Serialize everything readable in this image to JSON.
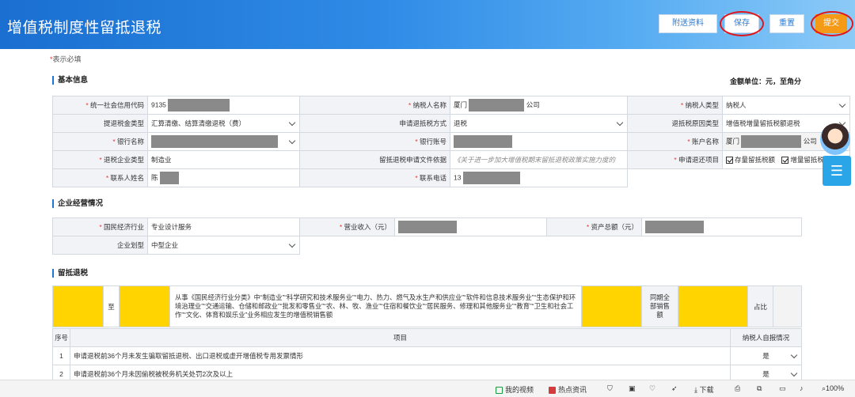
{
  "header": {
    "title": "增值税制度性留抵退税",
    "buttons": {
      "attach": "附送资料",
      "save": "保存",
      "reset": "重置",
      "submit": "提交"
    }
  },
  "required_note": {
    "star": "*",
    "text": "表示必填"
  },
  "basic": {
    "section_title": "基本信息",
    "unit_note": "金额单位：元，至角分",
    "credit_code_label": "统一社会信用代码",
    "credit_code_value": "9135",
    "taxpayer_name_label": "纳税人名称",
    "taxpayer_name_prefix": "厦门",
    "taxpayer_name_suffix": "公司",
    "taxpayer_type_label": "纳税人类型",
    "taxpayer_type_value": "纳税人",
    "refund_amount_type_label": "提退税金类型",
    "refund_amount_type_value": "汇算清缴、结算清缴退税（费）",
    "refund_method_label": "申请退抵税方式",
    "refund_method_value": "退税",
    "refund_reason_type_label": "退抵税原因类型",
    "refund_reason_type_value": "增值税增量留抵税额退税",
    "bank_name_label": "银行名称",
    "bank_account_label": "银行账号",
    "account_name_label": "账户名称",
    "account_name_prefix": "厦门",
    "account_name_suffix": "公司",
    "enterprise_type_label": "退税企业类型",
    "enterprise_type_value": "制造业",
    "policy_doc_label": "留抵退税申请文件依据",
    "policy_doc_value": "《关于进一步加大增值税期末留抵退税政策实施力度的",
    "refund_item_label": "申请退还项目",
    "refund_item_stock": "存量留抵税额",
    "refund_item_increment": "增量留抵税额",
    "contact_name_label": "联系人姓名",
    "contact_name_value": "陈",
    "contact_phone_label": "联系电话",
    "contact_phone_value": "13"
  },
  "business": {
    "section_title": "企业经营情况",
    "industry_label": "国民经济行业",
    "industry_value": "专业设计服务",
    "revenue_label": "营业收入（元）",
    "assets_label": "资产总额（元）",
    "scale_label": "企业划型",
    "scale_value": "中型企业"
  },
  "retention": {
    "section_title": "留抵退税",
    "to_label": "至",
    "industry_desc": "从事《国民经济行业分类》中“制造业”“科学研究和技术服务业”“电力、热力、燃气及水生产和供应业”“软件和信息技术服务业”“生态保护和环境治理业”“交通运输、仓储和邮政业”“批发和零售业”“农、林、牧、渔业”“住宿和餐饮业”“居民服务、修理和其他服务业”“教育”“卫生和社会工作”“文化、体育和娱乐业”业务相应发生的增值税销售额",
    "same_period_label": "同期全部销售额",
    "ratio_label": "占比",
    "col_seq": "序号",
    "col_item": "项目",
    "col_self_report": "纳税人自报情况",
    "rows": [
      {
        "seq": "1",
        "item": "申请退税前36个月未发生骗取留抵退税、出口退税或虚开增值税专用发票情形",
        "value": "是"
      },
      {
        "seq": "2",
        "item": "申请退税前36个月未因偷税被税务机关处罚2次及以上",
        "value": "是"
      }
    ]
  },
  "statusbar": {
    "video": "我的视频",
    "news": "热点资讯",
    "download": "下载",
    "zoom": "100%"
  }
}
